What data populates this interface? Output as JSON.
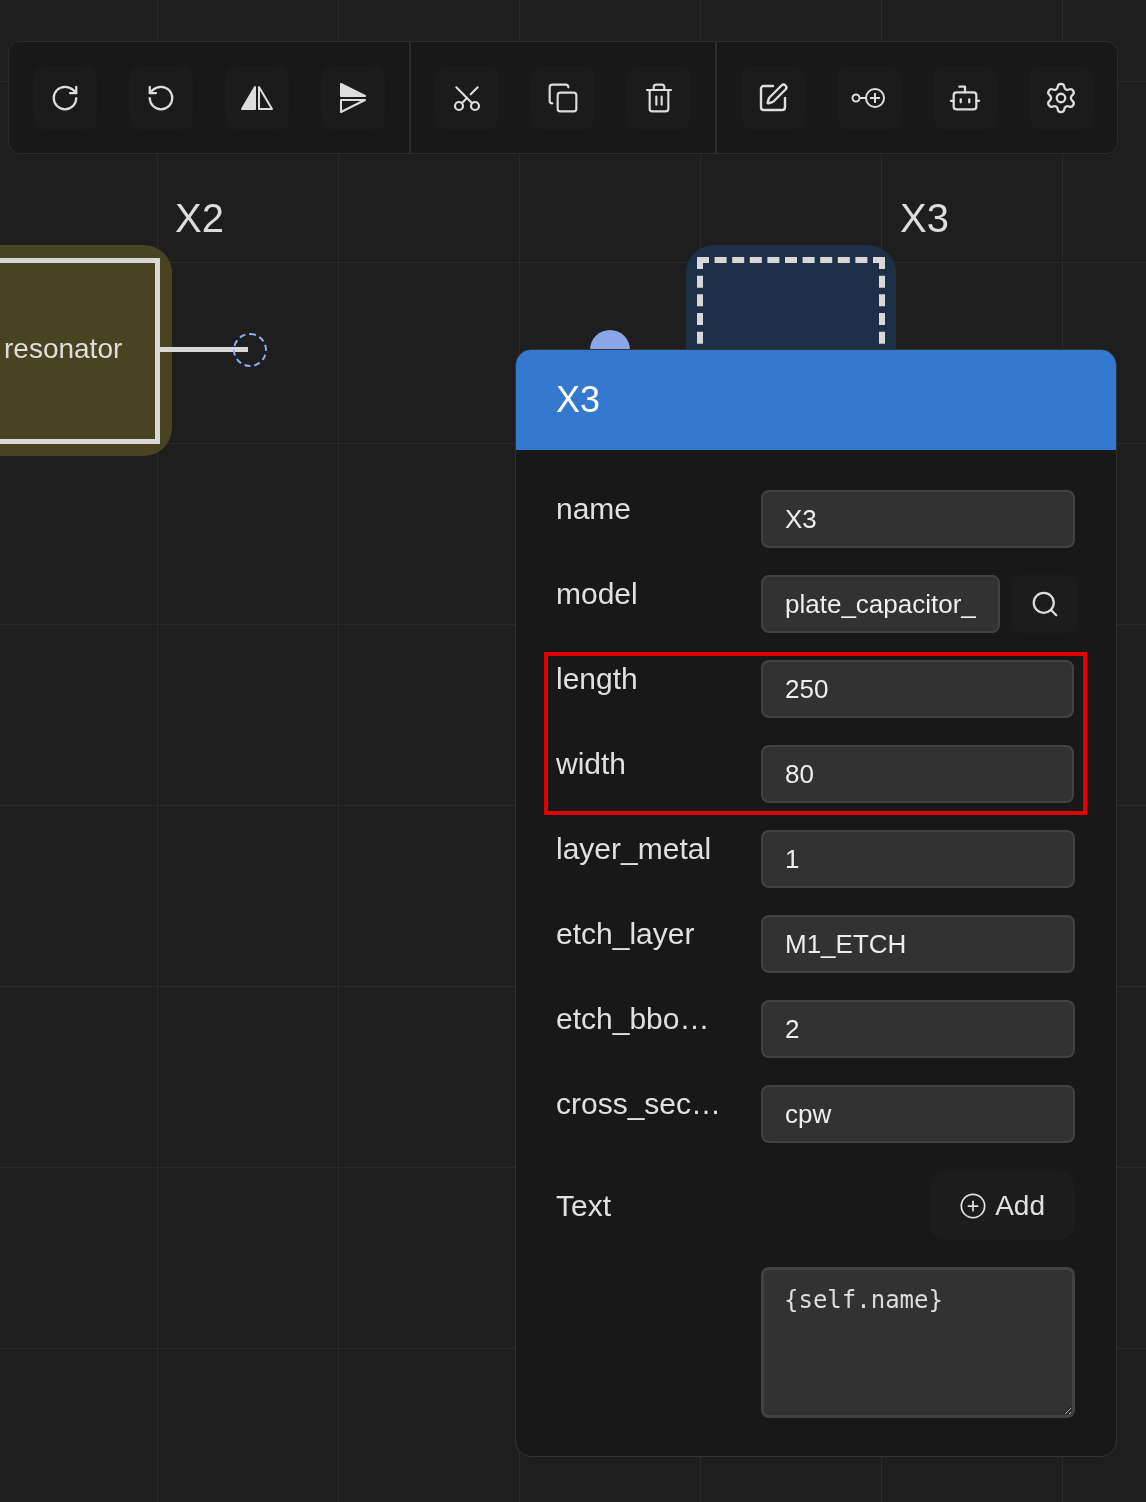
{
  "toolbar": {
    "groups": [
      {
        "buttons": [
          {
            "kind": "rotate-cw"
          },
          {
            "kind": "rotate-ccw"
          },
          {
            "kind": "flip-h"
          },
          {
            "kind": "flip-v"
          }
        ]
      },
      {
        "buttons": [
          {
            "kind": "cut"
          },
          {
            "kind": "copy"
          },
          {
            "kind": "delete"
          }
        ]
      },
      {
        "buttons": [
          {
            "kind": "edit"
          },
          {
            "kind": "add-port"
          },
          {
            "kind": "bot"
          },
          {
            "kind": "settings"
          }
        ]
      }
    ]
  },
  "canvas": {
    "nodes": [
      {
        "kind": "resonator",
        "label": "X2",
        "name": "resonator",
        "selected": false
      },
      {
        "kind": "capacitor",
        "label": "X3",
        "selected": true
      }
    ]
  },
  "panel": {
    "title": "X3",
    "fields": [
      {
        "label": "name",
        "value": "X3",
        "highlighted": false
      },
      {
        "label": "model",
        "value": "plate_capacitor_",
        "kind": "search",
        "highlighted": false
      },
      {
        "label": "length",
        "value": "250",
        "highlighted": true
      },
      {
        "label": "width",
        "value": "80",
        "highlighted": true
      },
      {
        "label": "layer_metal",
        "value": "1",
        "highlighted": false
      },
      {
        "label": "etch_layer",
        "value": "M1_ETCH",
        "highlighted": false
      },
      {
        "label": "etch_bbo…",
        "value": "2",
        "highlighted": false
      },
      {
        "label": "cross_sec…",
        "value": "cpw",
        "highlighted": false
      }
    ],
    "text_section": {
      "label": "Text",
      "add_button": "Add",
      "value": "{self.name}"
    }
  }
}
